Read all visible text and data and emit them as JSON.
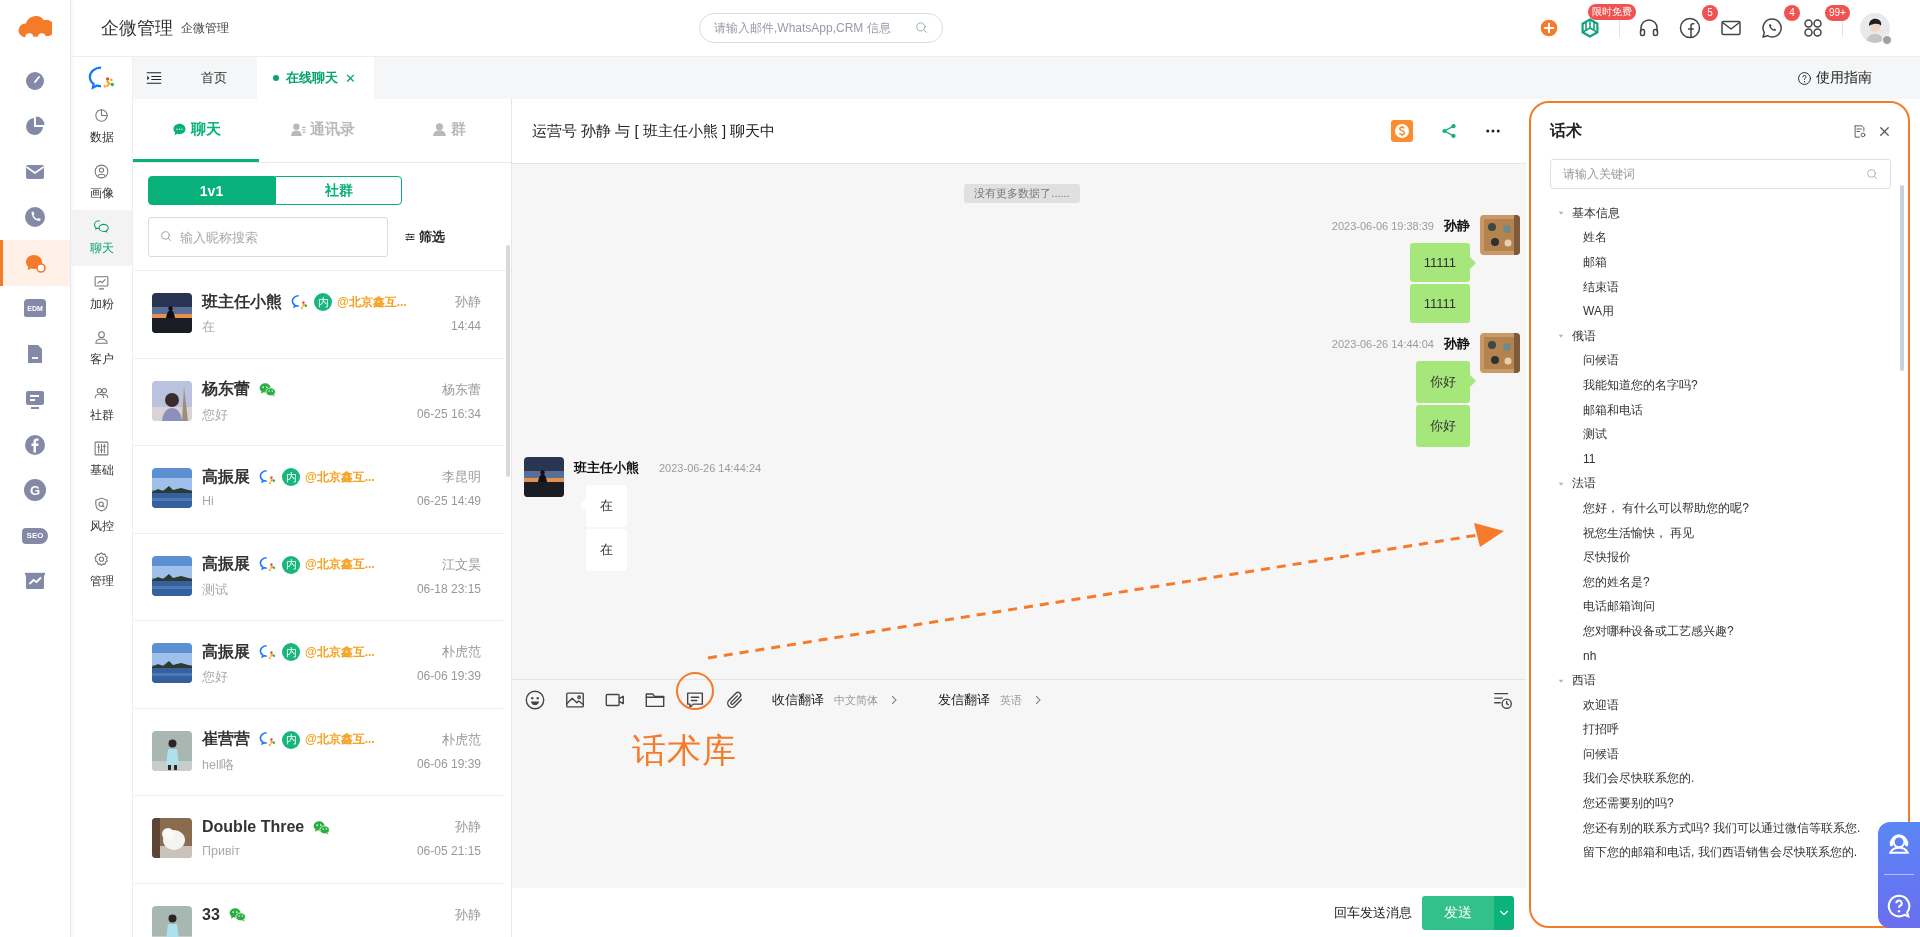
{
  "app": {
    "title": "企微管理",
    "subtitle": "企微管理"
  },
  "search": {
    "placeholder": "请输入邮件,WhatsApp,CRM 信息"
  },
  "header_icons": [
    {
      "kind": "plus"
    },
    {
      "kind": "ai",
      "badge": "限时免费"
    },
    {
      "kind": "headset"
    },
    {
      "kind": "facebook",
      "badge": "5"
    },
    {
      "kind": "mail"
    },
    {
      "kind": "whatsapp",
      "badge": "4"
    },
    {
      "kind": "apps",
      "badge": "99+"
    }
  ],
  "rail": [
    {
      "kind": "gauge",
      "selected": false
    },
    {
      "kind": "pie",
      "selected": false
    },
    {
      "kind": "mail",
      "selected": false
    },
    {
      "kind": "phone",
      "selected": false
    },
    {
      "kind": "chat",
      "selected": true
    },
    {
      "kind": "edm",
      "label": "EDM",
      "selected": false
    },
    {
      "kind": "doc",
      "selected": false
    },
    {
      "kind": "board",
      "selected": false
    },
    {
      "kind": "facebook",
      "selected": false
    },
    {
      "kind": "google",
      "label": "G",
      "selected": false
    },
    {
      "kind": "seo",
      "label": "SEO",
      "selected": false
    },
    {
      "kind": "chart",
      "selected": false
    }
  ],
  "nav": [
    {
      "kind": "data",
      "label": "数据",
      "selected": false
    },
    {
      "kind": "portrait",
      "label": "画像",
      "selected": false
    },
    {
      "kind": "chat",
      "label": "聊天",
      "selected": true
    },
    {
      "kind": "growth",
      "label": "加粉",
      "selected": false
    },
    {
      "kind": "customer",
      "label": "客户",
      "selected": false
    },
    {
      "kind": "community",
      "label": "社群",
      "selected": false
    },
    {
      "kind": "base",
      "label": "基础",
      "selected": false
    },
    {
      "kind": "risk",
      "label": "风控",
      "selected": false
    },
    {
      "kind": "admin",
      "label": "管理",
      "selected": false
    }
  ],
  "tabs": [
    {
      "label": "首页",
      "selected": false
    },
    {
      "label": "在线聊天",
      "selected": true,
      "close": "✕"
    }
  ],
  "guide": "使用指南",
  "list_tabs": [
    {
      "kind": "chat",
      "label": "聊天",
      "selected": true
    },
    {
      "kind": "contacts",
      "label": "通讯录",
      "selected": false
    },
    {
      "kind": "group",
      "label": "群",
      "selected": false
    }
  ],
  "segments": [
    {
      "label": "1v1",
      "selected": true
    },
    {
      "label": "社群",
      "selected": false
    }
  ],
  "contact_search": {
    "placeholder": "输入昵称搜索"
  },
  "filter": "筛选",
  "contacts": [
    {
      "name": "班主任小熊",
      "kind": "wecom",
      "tag": "内",
      "company": "@北京鑫互...",
      "owner": "孙静",
      "preview": "在",
      "time": "14:44"
    },
    {
      "name": "杨东蕾",
      "kind": "wechat",
      "owner": "杨东蕾",
      "preview": "您好",
      "time": "06-25 16:34"
    },
    {
      "name": "高振展",
      "kind": "wecom",
      "tag": "内",
      "company": "@北京鑫互...",
      "owner": "李昆明",
      "preview": "Hi",
      "time": "06-25 14:49"
    },
    {
      "name": "高振展",
      "kind": "wecom",
      "tag": "内",
      "company": "@北京鑫互...",
      "owner": "江文昊",
      "preview": "测试",
      "time": "06-18 23:15"
    },
    {
      "name": "高振展",
      "kind": "wecom",
      "tag": "内",
      "company": "@北京鑫互...",
      "owner": "朴虎范",
      "preview": "您好",
      "time": "06-06 19:39"
    },
    {
      "name": "崔营营",
      "kind": "wecom",
      "tag": "内",
      "company": "@北京鑫互...",
      "owner": "朴虎范",
      "preview": "hell咯",
      "time": "06-06 19:39"
    },
    {
      "name": "Double Three",
      "kind": "wechat",
      "owner": "孙静",
      "preview": "Привіт",
      "time": "06-05 21:15"
    },
    {
      "name": "33",
      "kind": "wechat",
      "owner": "孙静"
    }
  ],
  "chat": {
    "title": "运营号 孙静 与 [ 班主任小熊 ] 聊天中",
    "notice": "没有更多数据了......",
    "messages": [
      {
        "kind": "out",
        "sender": "孙静",
        "time": "2023-06-06 19:38:39",
        "bubbles": [
          "11111",
          "11111"
        ]
      },
      {
        "kind": "out",
        "sender": "孙静",
        "time": "2023-06-26 14:44:04",
        "bubbles": [
          "你好",
          "你好"
        ]
      },
      {
        "kind": "in",
        "sender": "班主任小熊",
        "time": "2023-06-26 14:44:24",
        "bubbles": [
          "在",
          "在"
        ]
      }
    ]
  },
  "toolbar": {
    "incoming": {
      "label": "收信翻译",
      "value": "中文简体"
    },
    "outgoing": {
      "label": "发信翻译",
      "value": "英语"
    }
  },
  "annotation": "话术库",
  "send": {
    "hint": "回车发送消息",
    "button": "发送"
  },
  "scripts": {
    "title": "话术",
    "placeholder": "请输入关键词",
    "groups": [
      {
        "label": "基本信息",
        "expanded": true,
        "children": [
          {
            "label": "姓名"
          },
          {
            "label": "邮箱"
          },
          {
            "label": "结束语"
          },
          {
            "label": "WA用"
          }
        ]
      },
      {
        "label": "俄语",
        "expanded": true,
        "children": [
          {
            "label": "问候语"
          },
          {
            "label": "我能知道您的名字吗?"
          },
          {
            "label": "邮箱和电话"
          },
          {
            "label": "测试"
          },
          {
            "label": "11"
          }
        ]
      },
      {
        "label": "法语",
        "expanded": true,
        "children": [
          {
            "label": "您好， 有什么可以帮助您的呢?"
          },
          {
            "label": "祝您生活愉快， 再见"
          },
          {
            "label": "尽快报价"
          },
          {
            "label": "您的姓名是?"
          },
          {
            "label": "电话邮箱询问"
          },
          {
            "label": "您对哪种设备或工艺感兴趣?"
          },
          {
            "label": "nh"
          }
        ]
      },
      {
        "label": "西语",
        "expanded": true,
        "children": [
          {
            "label": "欢迎语"
          },
          {
            "label": "打招呼"
          },
          {
            "label": "问候语"
          },
          {
            "label": "我们会尽快联系您的."
          },
          {
            "label": "您还需要别的吗?"
          },
          {
            "label": "您还有别的联系方式吗? 我们可以通过微信等联系您."
          },
          {
            "label": "留下您的邮箱和电话, 我们西语销售会尽快联系您的."
          }
        ]
      }
    ]
  }
}
